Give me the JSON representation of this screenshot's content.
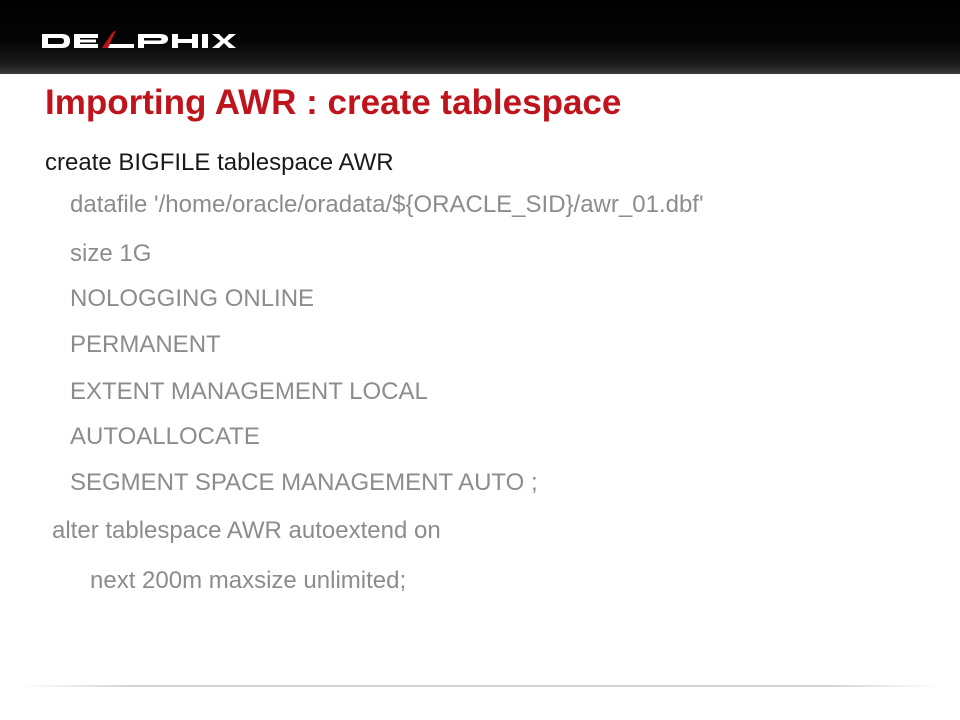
{
  "brand": {
    "logo_text": "DELPHIX",
    "logo_mark": "®"
  },
  "slide": {
    "title": "Importing AWR : create tablespace",
    "lines": [
      "create BIGFILE tablespace AWR",
      "datafile '/home/oracle/oradata/${ORACLE_SID}/awr_01.dbf'",
      "size 1G",
      "NOLOGGING ONLINE",
      "PERMANENT",
      "EXTENT MANAGEMENT LOCAL",
      "AUTOALLOCATE",
      "SEGMENT SPACE MANAGEMENT AUTO ;",
      "alter tablespace AWR autoextend on",
      "next 200m maxsize unlimited;"
    ]
  },
  "colors": {
    "title": "#c0141c",
    "header_bar": "#000000",
    "code_first_line": "#1a1a1a",
    "code_text": "#8c8c8c",
    "logo": "#ffffff"
  }
}
